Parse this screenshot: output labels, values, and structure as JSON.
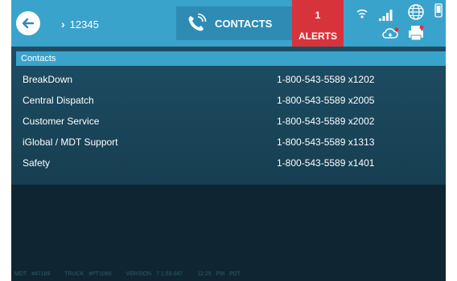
{
  "header": {
    "vehicle_id": "12345",
    "tab_label": "CONTACTS",
    "alerts_count": "1",
    "alerts_label": "ALERTS",
    "icons": [
      "back-arrow-icon",
      "phone-icon",
      "wifi-icon",
      "signal-icon",
      "globe-icon",
      "device-icon",
      "cloud-sync-icon",
      "printer-icon"
    ]
  },
  "contacts": {
    "title": "Contacts",
    "items": [
      {
        "name": "BreakDown",
        "phone": "1-800-543-5589 x1202"
      },
      {
        "name": "Central Dispatch",
        "phone": "1-800-543-5589 x2005"
      },
      {
        "name": "Customer Service",
        "phone": "1-800-543-5589 x2002"
      },
      {
        "name": "iGlobal / MDT Support",
        "phone": "1-800-543-5589 x1313"
      },
      {
        "name": "Safety",
        "phone": "1-800-543-5589 x1401"
      }
    ]
  },
  "footer": {
    "mdt": "MDT #47169",
    "truck": "TRUCK #PT1060",
    "version": "VERSION 7.1.59.047",
    "time": "12:25 PM PDT"
  },
  "colors": {
    "topbar": "#3aa3cc",
    "active_tab": "#2e8cb4",
    "alerts": "#d7333b",
    "panel": "#1d4d63",
    "background": "#0f2632"
  }
}
